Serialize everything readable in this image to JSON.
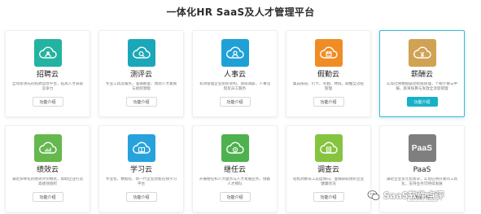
{
  "page": {
    "title": "一体化HR SaaS及人才管理平台"
  },
  "colors": {
    "recruit": "#23b3a0",
    "assess": "#1aa8b9",
    "hr": "#1fa1d8",
    "leave": "#f08c24",
    "salary": "#d0a254",
    "performance": "#65b84e",
    "learning": "#27a2dc",
    "succession": "#4db14f",
    "survey": "#86c440",
    "paas": "#7f7f7f",
    "active_border": "#40b8d4",
    "active_button": "#16b1c8"
  },
  "cards": [
    {
      "title": "招聘云",
      "desc": "全场景领先的招聘运营平台，提高人才获取竞争力",
      "button": "功能介绍",
      "icon": "cloud-person-icon"
    },
    {
      "title": "测评云",
      "desc": "专业工具及服务，准确衡量、预测人才素质与组织潜能",
      "button": "功能介绍",
      "icon": "cloud-search-icon"
    },
    {
      "title": "人事云",
      "desc": "有效管理企业组织架构，调岗调薪，人事流程及员工服务",
      "button": "功能介绍",
      "icon": "cloud-user-icon"
    },
    {
      "title": "假勤云",
      "desc": "集成排班、打卡、考勤、休假，助推全过程管理",
      "button": "功能介绍",
      "icon": "cloud-calendar-icon"
    },
    {
      "title": "薪酬云",
      "desc": "实现社保数据驱动智能管理，个税计算与申报，薪资核算与发放全流程管理",
      "button": "功能介绍",
      "icon": "cloud-money-icon",
      "active": true
    },
    {
      "title": "绩效云",
      "desc": "满足多样化的绩效评价模式，帮助企业打造高绩效组织",
      "button": "功能介绍",
      "icon": "cloud-chart-icon"
    },
    {
      "title": "学习云",
      "desc": "专业化、数据化、新一代企业智能在线学习平台",
      "button": "功能介绍",
      "icon": "cloud-book-icon"
    },
    {
      "title": "继任云",
      "desc": "开展继任和人才盘点与人才发展业务，储备人才梯队",
      "button": "功能介绍",
      "icon": "cloud-flow-icon"
    },
    {
      "title": "调查云",
      "desc": "轻松洞察员工态度倾向，准确获取组织企业健康状况",
      "button": "功能介绍",
      "icon": "cloud-survey-icon"
    },
    {
      "title": "PaaS",
      "desc": "满足企业多元化需求，实现应用开发的工具化，支持业务可持续发展",
      "button": "功能介绍",
      "icon": "paas-logo-icon",
      "logo_text": "PaaS"
    }
  ],
  "watermark": {
    "text": "SaaS软件点评"
  }
}
